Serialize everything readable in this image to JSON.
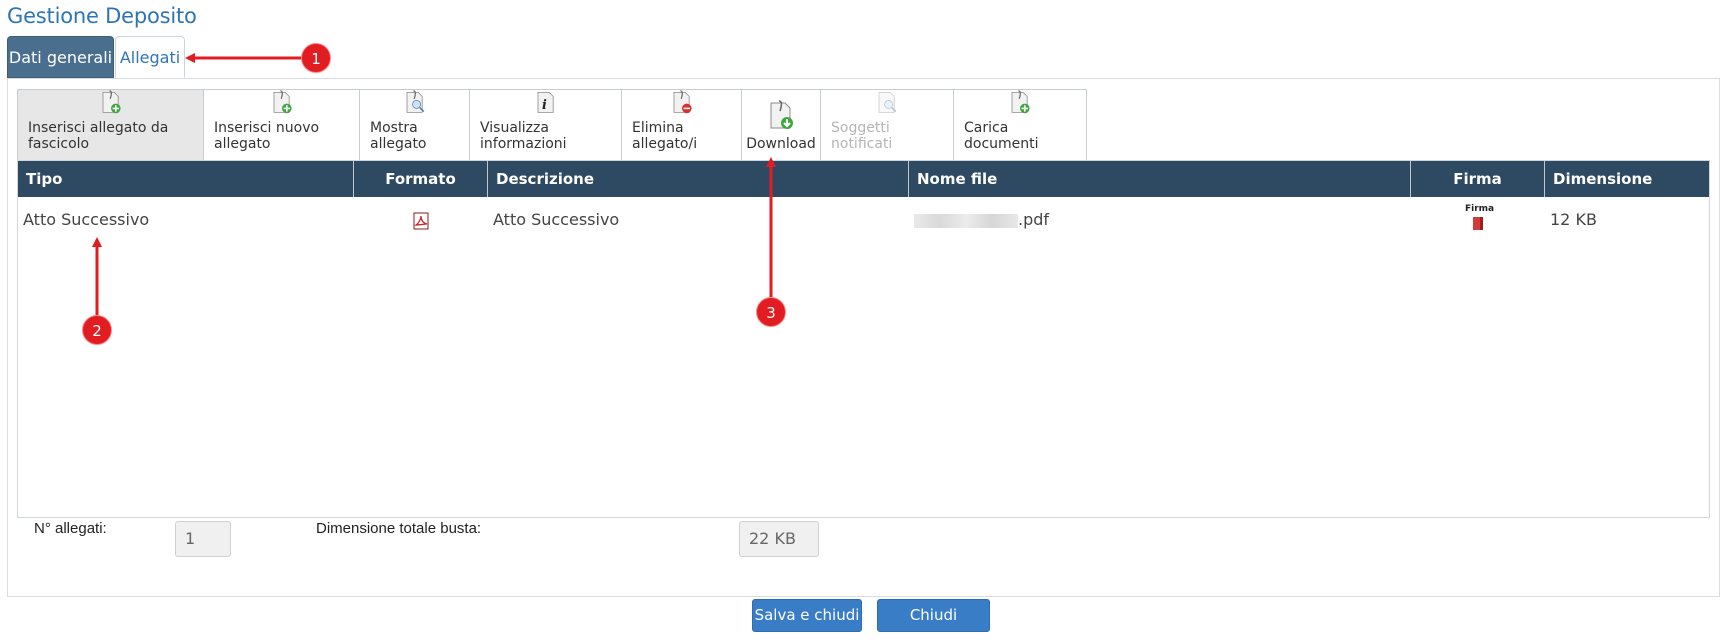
{
  "title": "Gestione Deposito",
  "tabs": [
    "Dati generali",
    "Allegati"
  ],
  "toolbar": {
    "buttons": [
      {
        "label": "Inserisci allegato da fascicolo",
        "icon": "add-from-folder-icon"
      },
      {
        "label": "Inserisci nuovo allegato",
        "icon": "add-attachment-icon"
      },
      {
        "label": "Mostra allegato",
        "icon": "view-attachment-icon"
      },
      {
        "label": "Visualizza informazioni",
        "icon": "info-icon"
      },
      {
        "label": "Elimina allegato/i",
        "icon": "delete-attachment-icon"
      },
      {
        "label": "Download",
        "icon": "download-icon"
      },
      {
        "label": "Soggetti notificati",
        "icon": "notified-subjects-icon"
      },
      {
        "label": "Carica documenti",
        "icon": "upload-documents-icon"
      }
    ]
  },
  "grid": {
    "columns": [
      "Tipo",
      "Formato",
      "Descrizione",
      "Nome file",
      "Firma",
      "Dimensione"
    ],
    "rows": [
      {
        "tipo": "Atto Successivo",
        "formato_icon": "pdf-icon",
        "descrizione": "Atto Successivo",
        "nome_file_suffix": ".pdf",
        "firma_icon": "signature-icon",
        "firma_text": "Firma",
        "dimensione": "12 KB"
      }
    ]
  },
  "footer": {
    "n_allegati_label": "N° allegati:",
    "n_allegati_value": "1",
    "dim_label": "Dimensione totale busta:",
    "dim_value": "22 KB"
  },
  "buttons": {
    "save": "Salva e chiudi",
    "close": "Chiudi"
  },
  "annotations": [
    "1",
    "2",
    "3"
  ],
  "colors": {
    "header_bg": "#2e4a62",
    "accent": "#2e75b6",
    "annotation": "#e11d22",
    "button": "#3a7dc7"
  }
}
